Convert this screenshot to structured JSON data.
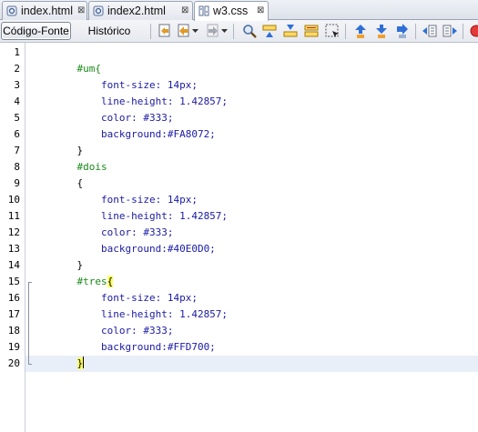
{
  "tabs": [
    {
      "label": "index.html",
      "icon": "html-file-icon",
      "active": false,
      "bold": false
    },
    {
      "label": "index2.html",
      "icon": "html-file-icon",
      "active": false,
      "bold": true
    },
    {
      "label": "w3.css",
      "icon": "css-file-icon",
      "active": true,
      "bold": false
    }
  ],
  "toolbar": {
    "source_label": "Código-Fonte",
    "history_label": "Histórico",
    "icons": [
      "last-edit-icon",
      "back-icon",
      "forward-icon",
      "find-icon",
      "find-previous-icon",
      "find-next-icon",
      "find-selection-icon",
      "toggle-highlight-icon",
      "toggle-rectangular-selection-icon",
      "previous-bookmark-icon",
      "next-bookmark-icon",
      "toggle-bookmark-icon",
      "shift-left-icon",
      "shift-right-icon",
      "start-macro-icon"
    ]
  },
  "editor": {
    "line_numbers": [
      "1",
      "2",
      "3",
      "4",
      "5",
      "6",
      "7",
      "8",
      "9",
      "10",
      "11",
      "12",
      "13",
      "14",
      "15",
      "16",
      "17",
      "18",
      "19",
      "20"
    ],
    "current_line": 20,
    "lines": [
      [],
      [
        {
          "t": "    #um{",
          "c": "sel"
        }
      ],
      [
        {
          "t": "        font-size: 14px;",
          "c": "prop"
        }
      ],
      [
        {
          "t": "        line-height: 1.42857;",
          "c": "prop"
        }
      ],
      [
        {
          "t": "        color: #333;",
          "c": "prop"
        }
      ],
      [
        {
          "t": "        background:#FA8072;",
          "c": "prop"
        }
      ],
      [
        {
          "t": "    }",
          "c": "brace"
        }
      ],
      [
        {
          "t": "    #dois",
          "c": "sel"
        }
      ],
      [
        {
          "t": "    {",
          "c": "brace"
        }
      ],
      [
        {
          "t": "        font-size: 14px;",
          "c": "prop"
        }
      ],
      [
        {
          "t": "        line-height: 1.42857;",
          "c": "prop"
        }
      ],
      [
        {
          "t": "        color: #333;",
          "c": "prop"
        }
      ],
      [
        {
          "t": "        background:#40E0D0;",
          "c": "prop"
        }
      ],
      [
        {
          "t": "    }",
          "c": "brace"
        }
      ],
      [
        {
          "t": "    #tres",
          "c": "sel"
        },
        {
          "t": "{",
          "c": "brace hl"
        }
      ],
      [
        {
          "t": "        font-size: 14px;",
          "c": "prop"
        }
      ],
      [
        {
          "t": "        line-height: 1.42857;",
          "c": "prop"
        }
      ],
      [
        {
          "t": "        color: #333;",
          "c": "prop"
        }
      ],
      [
        {
          "t": "        background:#FFD700;",
          "c": "prop"
        }
      ],
      [
        {
          "t": "    ",
          "c": "brace"
        },
        {
          "t": "}",
          "c": "brace hl"
        }
      ]
    ]
  }
}
